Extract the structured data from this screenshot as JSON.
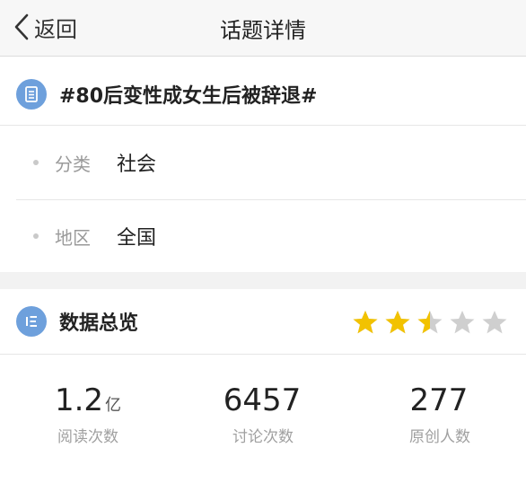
{
  "nav": {
    "back_label": "返回",
    "title": "话题详情"
  },
  "topic": {
    "title": "#80后变性成女生后被辞退#",
    "category_label": "分类",
    "category_value": "社会",
    "region_label": "地区",
    "region_value": "全国"
  },
  "stats": {
    "title": "数据总览",
    "rating": 2.5,
    "rating_max": 5,
    "star_filled_color": "#f2c200",
    "star_empty_color": "#cfcfcf",
    "metrics": [
      {
        "value": "1.2",
        "unit": "亿",
        "label": "阅读次数"
      },
      {
        "value": "6457",
        "unit": "",
        "label": "讨论次数"
      },
      {
        "value": "277",
        "unit": "",
        "label": "原创人数"
      }
    ]
  },
  "colors": {
    "accent_blue": "#6ea0dc",
    "background": "#f2f2f2"
  }
}
